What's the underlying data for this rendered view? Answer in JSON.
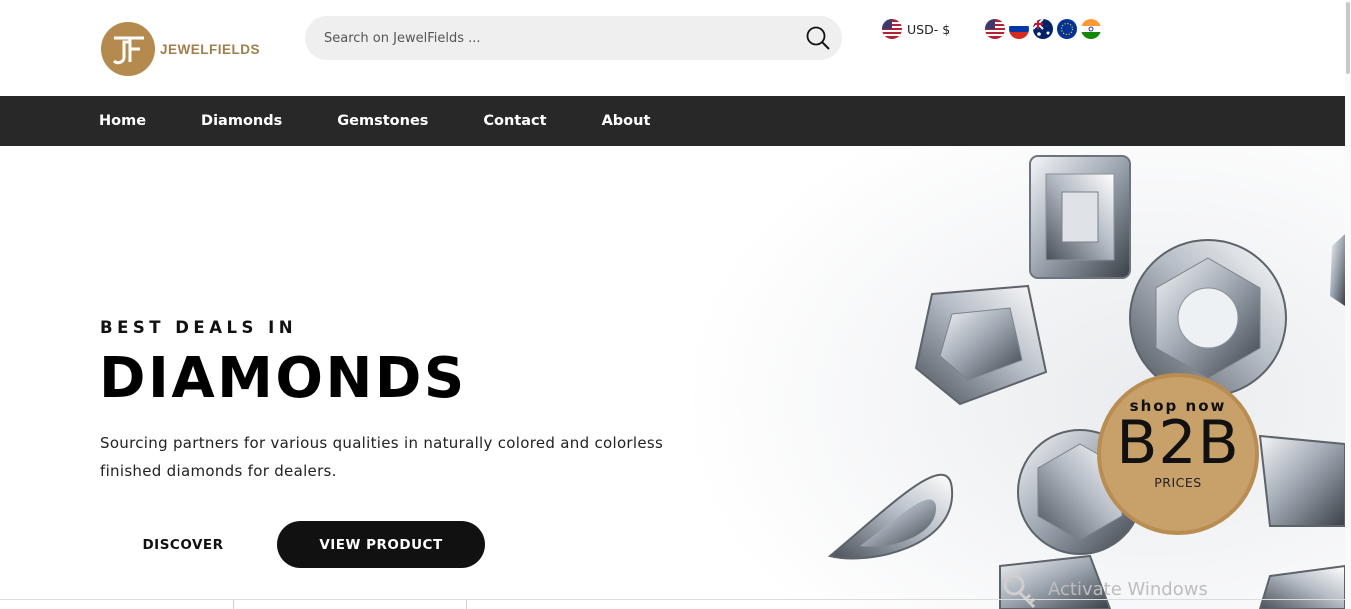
{
  "brand": {
    "name": "JEWELFIELDS",
    "accent": "#a07f4a"
  },
  "search": {
    "placeholder": "Search on JewelFields ..."
  },
  "currency": {
    "label": "USD- $"
  },
  "flags": [
    "us-flag-icon",
    "ru-flag-icon",
    "au-flag-icon",
    "eu-flag-icon",
    "in-flag-icon"
  ],
  "nav": {
    "items": [
      "Home",
      "Diamonds",
      "Gemstones",
      "Contact",
      "About"
    ],
    "background": "#282828"
  },
  "hero": {
    "kicker": "BEST DEALS IN",
    "headline": "DIAMONDS",
    "description_line1": "Sourcing partners for various qualities in naturally colored and colorless",
    "description_line2": "finished diamonds for dealers.",
    "discover_label": "DISCOVER",
    "view_product_label": "VIEW PRODUCT"
  },
  "badge": {
    "top": "shop now",
    "main": "B2B",
    "bottom": "PRICES",
    "color": "#c8a06a"
  },
  "watermark": {
    "text": "Activate Windows"
  }
}
